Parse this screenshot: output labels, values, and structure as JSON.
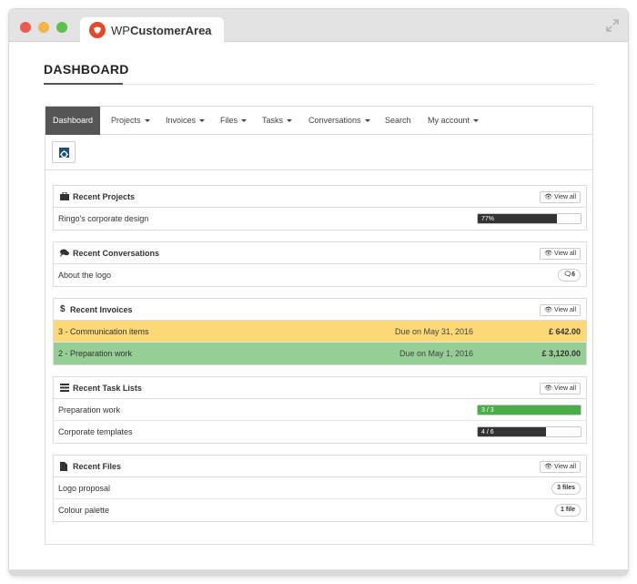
{
  "browser": {
    "tab_title_prefix": "WP",
    "tab_title_bold": "CustomerArea",
    "expand_icon": "expand-icon"
  },
  "page": {
    "title": "DASHBOARD"
  },
  "nav": {
    "items": [
      {
        "label": "Dashboard",
        "active": true,
        "dropdown": false
      },
      {
        "label": "Projects",
        "dropdown": true
      },
      {
        "label": "Invoices",
        "dropdown": true
      },
      {
        "label": "Files",
        "dropdown": true
      },
      {
        "label": "Tasks",
        "dropdown": true
      },
      {
        "label": "Conversations",
        "dropdown": true
      },
      {
        "label": "Search",
        "dropdown": false
      },
      {
        "label": "My account",
        "dropdown": true
      }
    ]
  },
  "toolbar": {
    "icon": "dashboard-icon"
  },
  "sections": {
    "projects": {
      "title": "Recent Projects",
      "icon": "briefcase-icon",
      "view_all": "View all",
      "rows": [
        {
          "label": "Ringo's corporate design",
          "progress_text": "77%",
          "progress": 0.77
        }
      ]
    },
    "conversations": {
      "title": "Recent Conversations",
      "icon": "comments-icon",
      "view_all": "View all",
      "rows": [
        {
          "label": "About the logo",
          "count": "6"
        }
      ]
    },
    "invoices": {
      "title": "Recent Invoices",
      "icon": "dollar-icon",
      "icon_text": "$",
      "view_all": "View all",
      "rows": [
        {
          "label": "3 - Communication items",
          "due": "Due on May 31, 2016",
          "amount": "£ 642.00",
          "status_color": "#fcd975"
        },
        {
          "label": "2 - Preparation work",
          "due": "Due on May 1, 2016",
          "amount": "£ 3,120.00",
          "status_color": "#95cf95"
        }
      ]
    },
    "tasks": {
      "title": "Recent Task Lists",
      "icon": "list-icon",
      "view_all": "View all",
      "rows": [
        {
          "label": "Preparation work",
          "progress_text": "3 / 3",
          "progress": 1.0
        },
        {
          "label": "Corporate templates",
          "progress_text": "4 / 6",
          "progress": 0.667
        }
      ]
    },
    "files": {
      "title": "Recent Files",
      "icon": "file-icon",
      "view_all": "View all",
      "rows": [
        {
          "label": "Logo proposal",
          "count": "3 files"
        },
        {
          "label": "Colour palette",
          "count": "1 file"
        }
      ]
    }
  },
  "colors": {
    "accent_dark": "#555555",
    "brand": "#e24a2c",
    "progress_green": "#4aae48"
  }
}
